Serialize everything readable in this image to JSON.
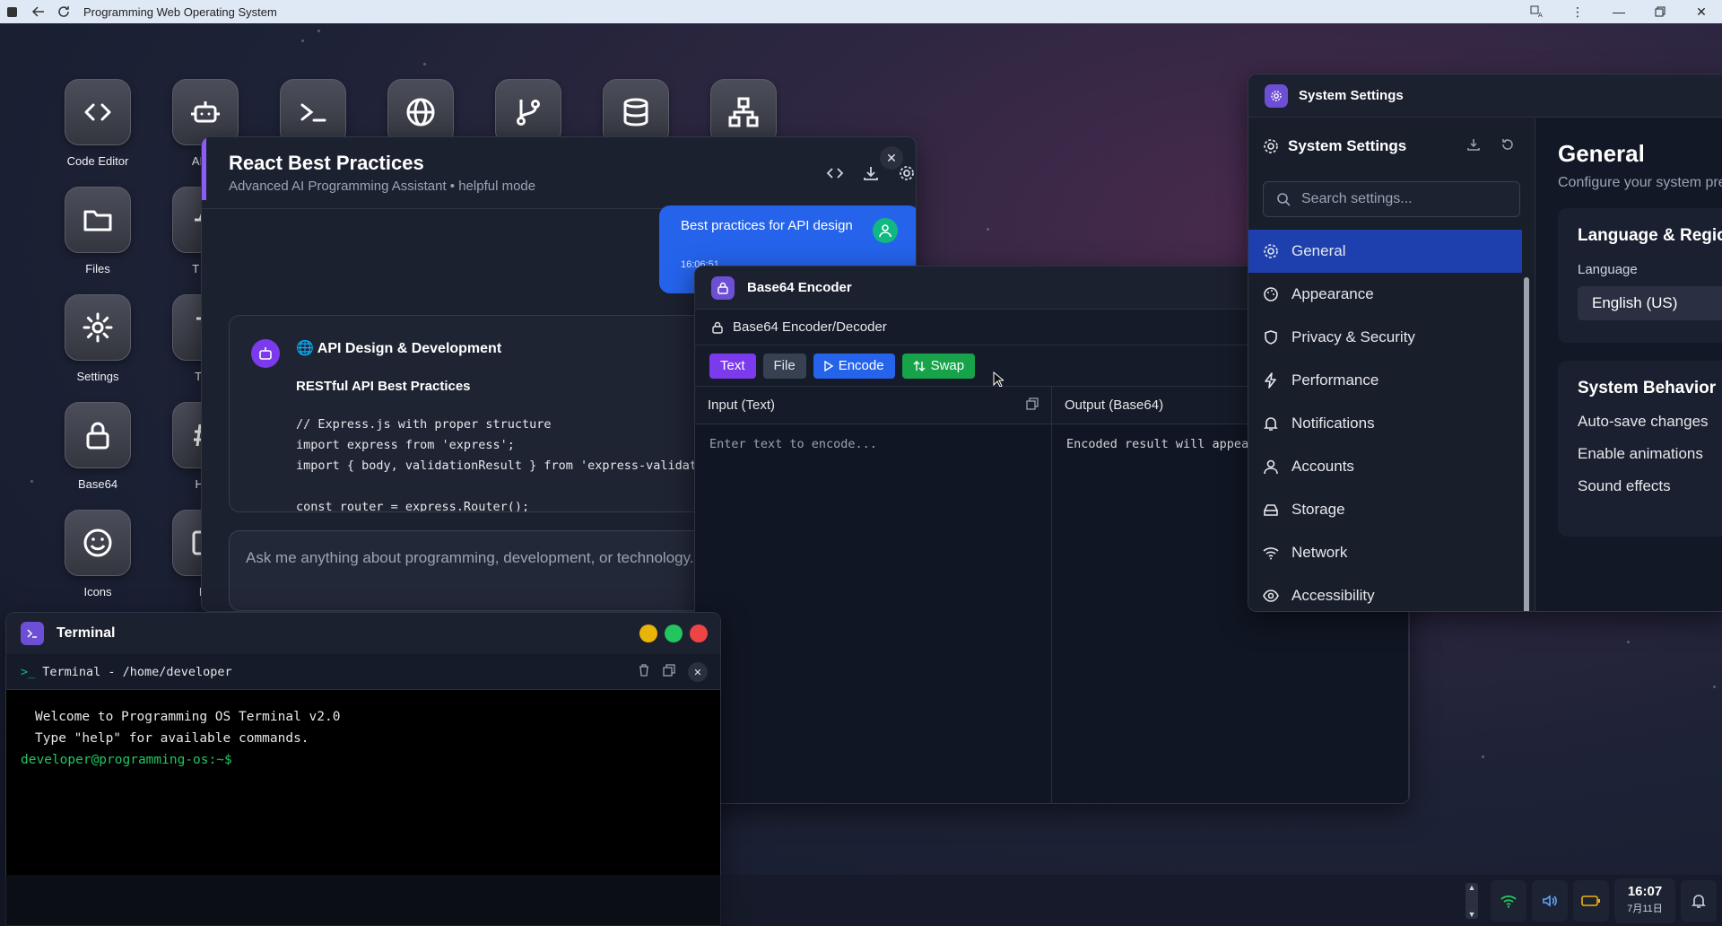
{
  "browser": {
    "title": "Programming Web Operating System"
  },
  "desktop": {
    "icons": [
      {
        "label": "Code Editor",
        "icon": "code-icon"
      },
      {
        "label": "AI As",
        "icon": "bot-icon"
      },
      {
        "label": "",
        "icon": "terminal-icon"
      },
      {
        "label": "",
        "icon": "globe-icon"
      },
      {
        "label": "",
        "icon": "git-branch-icon"
      },
      {
        "label": "",
        "icon": "database-icon"
      },
      {
        "label": "",
        "icon": "network-icon"
      },
      {
        "label": "Files",
        "icon": "folder-icon"
      },
      {
        "label": "T Ma",
        "icon": "task-icon"
      },
      {
        "label": "Settings",
        "icon": "gear-icon"
      },
      {
        "label": "Text",
        "icon": "text-icon"
      },
      {
        "label": "Base64",
        "icon": "lock-icon"
      },
      {
        "label": "Has",
        "icon": "hash-icon"
      },
      {
        "label": "Icons",
        "icon": "smile-icon"
      },
      {
        "label": "Im",
        "icon": "image-icon"
      }
    ]
  },
  "ai_window": {
    "title": "React Best Practices",
    "subtitle": "Advanced AI Programming Assistant • helpful mode",
    "user_message": "Best practices for API design",
    "user_time": "16:06:51",
    "response_title": "API Design & Development",
    "response_heading": "RESTful API Best Practices",
    "code_lines": [
      "// Express.js with proper structure",
      "import express from 'express';",
      "import { body, validationResult } from 'express-validator';",
      "",
      "const router = express.Router();"
    ],
    "input_placeholder": "Ask me anything about programming, development, or technology..."
  },
  "base64_window": {
    "title": "Base64 Encoder",
    "subtitle": "Base64 Encoder/Decoder",
    "btn_text": "Text",
    "btn_file": "File",
    "btn_encode": "Encode",
    "btn_swap": "Swap",
    "input_label": "Input (Text)",
    "input_placeholder": "Enter text to encode...",
    "output_label": "Output (Base64)",
    "output_placeholder": "Encoded result will appear here..."
  },
  "settings_window": {
    "title": "System Settings",
    "sidebar_title": "System Settings",
    "search_placeholder": "Search settings...",
    "nav": [
      {
        "label": "General",
        "icon": "gear-icon",
        "active": true
      },
      {
        "label": "Appearance",
        "icon": "palette-icon"
      },
      {
        "label": "Privacy & Security",
        "icon": "shield-icon"
      },
      {
        "label": "Performance",
        "icon": "bolt-icon"
      },
      {
        "label": "Notifications",
        "icon": "bell-icon"
      },
      {
        "label": "Accounts",
        "icon": "user-icon"
      },
      {
        "label": "Storage",
        "icon": "drive-icon"
      },
      {
        "label": "Network",
        "icon": "wifi-icon"
      },
      {
        "label": "Accessibility",
        "icon": "eye-icon"
      }
    ],
    "main_title": "General",
    "main_desc": "Configure your system preferences",
    "lang_section": "Language & Region",
    "lang_label": "Language",
    "lang_value": "English (US)",
    "behavior_section": "System Behavior",
    "behavior_options": [
      "Auto-save changes",
      "Enable animations",
      "Sound effects"
    ]
  },
  "terminal": {
    "title": "Terminal",
    "path": "Terminal - /home/developer",
    "lines": [
      "Welcome to Programming OS Terminal v2.0",
      "Type \"help\" for available commands."
    ],
    "prompt": "developer@programming-os:~$"
  },
  "taskbar": {
    "time": "16:07",
    "date": "7月11日"
  },
  "colors": {
    "accent_purple": "#7c3aed",
    "accent_blue": "#2563eb",
    "accent_green": "#16a34a"
  }
}
